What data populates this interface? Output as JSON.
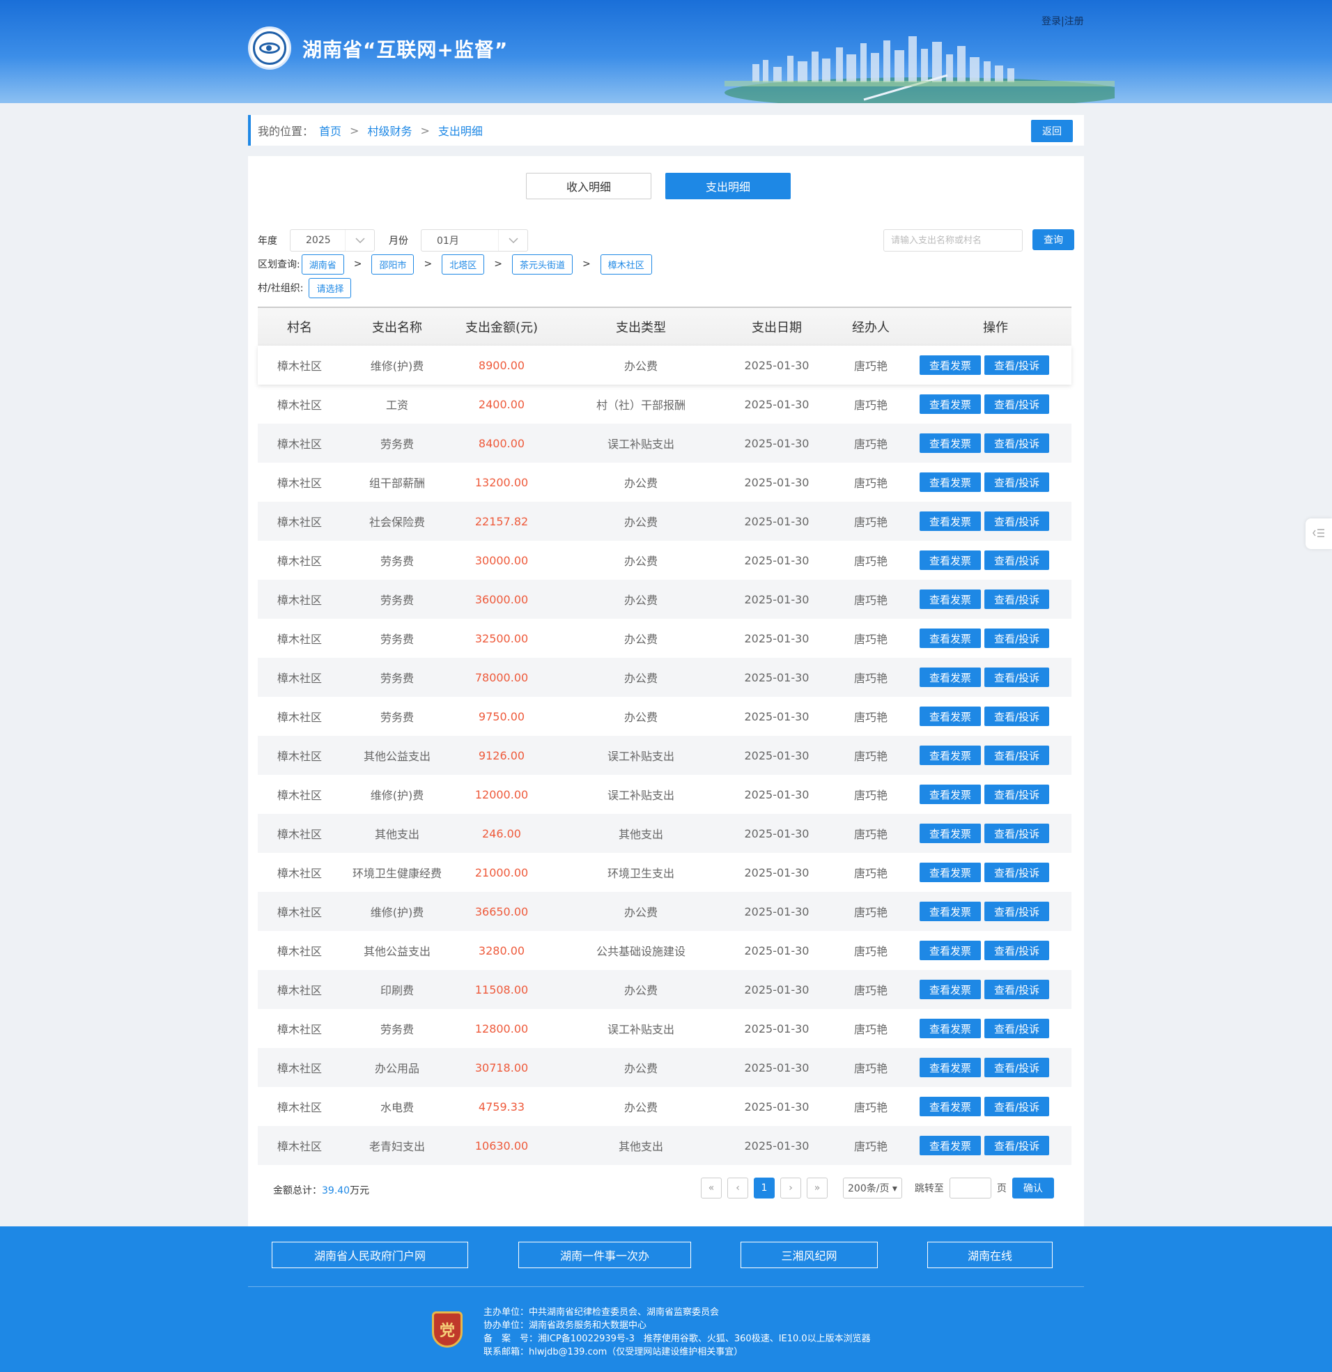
{
  "header": {
    "site_title": "湖南省“互联网+监督”",
    "login": "登录",
    "divider": "|",
    "register": "注册"
  },
  "breadcrumb": {
    "label": "我的位置：",
    "items": [
      "首页",
      "村级财务",
      "支出明细"
    ],
    "back": "返回"
  },
  "tabs": [
    {
      "label": "收入明细",
      "active": false
    },
    {
      "label": "支出明细",
      "active": true
    }
  ],
  "filters": {
    "year_label": "年度",
    "year_value": "2025",
    "month_label": "月份",
    "month_value": "01月",
    "search_placeholder": "请输入支出名称或村名",
    "query": "查询",
    "region_label": "区划查询:",
    "regions": [
      "湖南省",
      "邵阳市",
      "北塔区",
      "茶元头街道",
      "樟木社区"
    ],
    "region_sep": ">",
    "org_label": "村/社组织:",
    "org_value": "请选择"
  },
  "table": {
    "headers": [
      "村名",
      "支出名称",
      "支出金额(元)",
      "支出类型",
      "支出日期",
      "经办人",
      "操作"
    ],
    "btn_invoice": "查看发票",
    "btn_complaint": "查看/投诉",
    "rows": [
      [
        "樟木社区",
        "维修(护)费",
        "8900.00",
        "办公费",
        "2025-01-30",
        "唐巧艳"
      ],
      [
        "樟木社区",
        "工资",
        "2400.00",
        "村（社）干部报酬",
        "2025-01-30",
        "唐巧艳"
      ],
      [
        "樟木社区",
        "劳务费",
        "8400.00",
        "误工补贴支出",
        "2025-01-30",
        "唐巧艳"
      ],
      [
        "樟木社区",
        "组干部薪酬",
        "13200.00",
        "办公费",
        "2025-01-30",
        "唐巧艳"
      ],
      [
        "樟木社区",
        "社会保险费",
        "22157.82",
        "办公费",
        "2025-01-30",
        "唐巧艳"
      ],
      [
        "樟木社区",
        "劳务费",
        "30000.00",
        "办公费",
        "2025-01-30",
        "唐巧艳"
      ],
      [
        "樟木社区",
        "劳务费",
        "36000.00",
        "办公费",
        "2025-01-30",
        "唐巧艳"
      ],
      [
        "樟木社区",
        "劳务费",
        "32500.00",
        "办公费",
        "2025-01-30",
        "唐巧艳"
      ],
      [
        "樟木社区",
        "劳务费",
        "78000.00",
        "办公费",
        "2025-01-30",
        "唐巧艳"
      ],
      [
        "樟木社区",
        "劳务费",
        "9750.00",
        "办公费",
        "2025-01-30",
        "唐巧艳"
      ],
      [
        "樟木社区",
        "其他公益支出",
        "9126.00",
        "误工补贴支出",
        "2025-01-30",
        "唐巧艳"
      ],
      [
        "樟木社区",
        "维修(护)费",
        "12000.00",
        "误工补贴支出",
        "2025-01-30",
        "唐巧艳"
      ],
      [
        "樟木社区",
        "其他支出",
        "246.00",
        "其他支出",
        "2025-01-30",
        "唐巧艳"
      ],
      [
        "樟木社区",
        "环境卫生健康经费",
        "21000.00",
        "环境卫生支出",
        "2025-01-30",
        "唐巧艳"
      ],
      [
        "樟木社区",
        "维修(护)费",
        "36650.00",
        "办公费",
        "2025-01-30",
        "唐巧艳"
      ],
      [
        "樟木社区",
        "其他公益支出",
        "3280.00",
        "公共基础设施建设",
        "2025-01-30",
        "唐巧艳"
      ],
      [
        "樟木社区",
        "印刷费",
        "11508.00",
        "办公费",
        "2025-01-30",
        "唐巧艳"
      ],
      [
        "樟木社区",
        "劳务费",
        "12800.00",
        "误工补贴支出",
        "2025-01-30",
        "唐巧艳"
      ],
      [
        "樟木社区",
        "办公用品",
        "30718.00",
        "办公费",
        "2025-01-30",
        "唐巧艳"
      ],
      [
        "樟木社区",
        "水电费",
        "4759.33",
        "办公费",
        "2025-01-30",
        "唐巧艳"
      ],
      [
        "樟木社区",
        "老青妇支出",
        "10630.00",
        "其他支出",
        "2025-01-30",
        "唐巧艳"
      ]
    ]
  },
  "summary": {
    "label": "金额总计：",
    "total": "39.40",
    "unit": "万元"
  },
  "pager": {
    "first": "«",
    "prev": "‹",
    "current": "1",
    "next": "›",
    "last": "»",
    "page_size": "200条/页 ▾",
    "jump_label": "跳转至",
    "page_unit": "页",
    "confirm": "确认"
  },
  "footer": {
    "links": [
      "湖南省人民政府门户网",
      "湖南一件事一次办",
      "三湘风纪网",
      "湖南在线"
    ],
    "badge_char": "党",
    "info": [
      "主办单位：中共湖南省纪律检查委员会、湖南省监察委员会",
      "协办单位：湖南省政务服务和大数据中心",
      "备　案　号：湘ICP备10022939号-3　推荐使用谷歌、火狐、360极速、IE10.0以上版本浏览器",
      "联系邮箱：hlwjdb@139.com（仅受理网站建设维护相关事宜）"
    ]
  },
  "side_tab_icon": "menu-icon",
  "colors": {
    "accent": "#1e88e5",
    "amount": "#ee5a3b"
  }
}
